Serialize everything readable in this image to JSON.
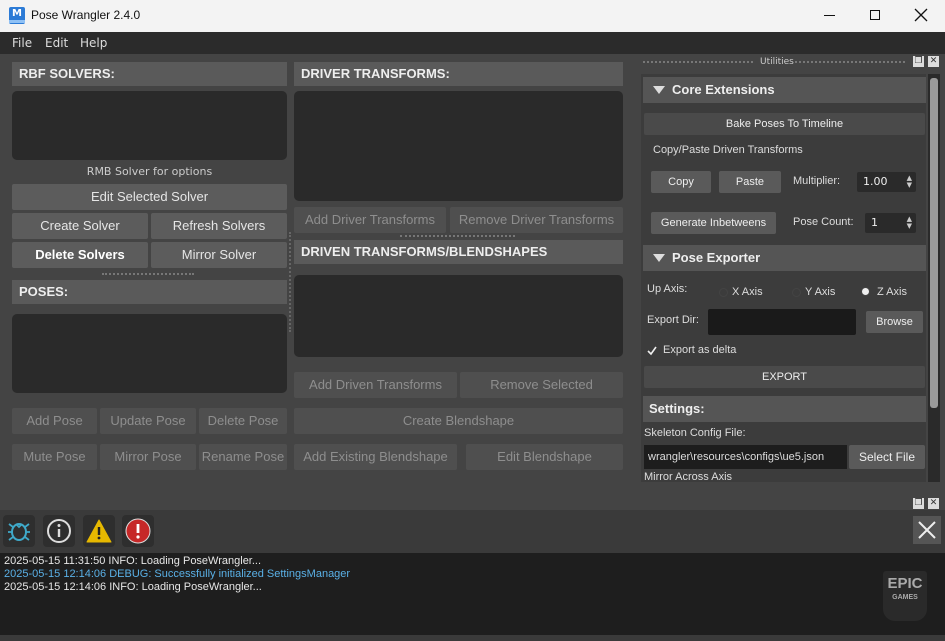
{
  "window": {
    "title": "Pose Wrangler 2.4.0",
    "icon_glyph": "M"
  },
  "menu": [
    "File",
    "Edit",
    "Help"
  ],
  "left": {
    "rbf_header": "RBF SOLVERS:",
    "rbf_hint": "RMB Solver for options",
    "edit_selected_solver": "Edit Selected Solver",
    "create_solver": "Create Solver",
    "refresh_solvers": "Refresh Solvers",
    "delete_solvers": "Delete Solvers",
    "mirror_solver": "Mirror Solver",
    "poses_header": "POSES:",
    "add_pose": "Add Pose",
    "update_pose": "Update Pose",
    "delete_pose": "Delete Pose",
    "mute_pose": "Mute Pose",
    "mirror_pose": "Mirror Pose",
    "rename_pose": "Rename Pose"
  },
  "middle": {
    "driver_header": "DRIVER TRANSFORMS:",
    "add_driver": "Add Driver Transforms",
    "remove_driver": "Remove Driver Transforms",
    "driven_header": "DRIVEN TRANSFORMS/BLENDSHAPES",
    "add_driven": "Add Driven Transforms",
    "remove_selected": "Remove Selected",
    "create_blendshape": "Create Blendshape",
    "add_existing_blendshape": "Add Existing Blendshape",
    "edit_blendshape": "Edit Blendshape"
  },
  "utilities": {
    "title": "Utilities",
    "core_header": "Core Extensions",
    "bake_poses": "Bake Poses To Timeline",
    "copy_paste_label": "Copy/Paste Driven Transforms",
    "copy": "Copy",
    "paste": "Paste",
    "multiplier_label": "Multiplier:",
    "multiplier_value": "1.00",
    "generate_inbetweens": "Generate Inbetweens",
    "pose_count_label": "Pose Count:",
    "pose_count_value": "1",
    "exporter_header": "Pose Exporter",
    "up_axis_label": "Up Axis:",
    "x_axis": "X Axis",
    "y_axis": "Y Axis",
    "z_axis": "Z Axis",
    "selected_axis": "Z Axis",
    "export_dir_label": "Export Dir:",
    "browse": "Browse",
    "export_as_delta": "Export as delta",
    "export_as_delta_checked": true,
    "export": "EXPORT",
    "settings_header": "Settings:",
    "skeleton_config_label": "Skeleton Config File:",
    "skeleton_config_path": "wrangler\\resources\\configs\\ue5.json",
    "select_file": "Select File",
    "mirror_across_axis": "Mirror Across Axis"
  },
  "log": {
    "lines": [
      {
        "text": "2025-05-15 11:31:50 INFO: Loading PoseWrangler...",
        "level": "info"
      },
      {
        "text": "2025-05-15 12:14:06 DEBUG: Successfully initialized SettingsManager",
        "level": "debug"
      },
      {
        "text": "2025-05-15 12:14:06 INFO: Loading PoseWrangler...",
        "level": "info"
      }
    ],
    "filters": [
      "debug-filter-icon",
      "info-filter-icon",
      "warning-filter-icon",
      "error-filter-icon"
    ],
    "logo_line1": "EPIC",
    "logo_line2": "GAMES"
  },
  "colors": {
    "info_text": "#e6e6e6",
    "debug_text": "#5ab0e6",
    "warning": "#e6b800",
    "error": "#c62828",
    "debug_icon": "#3fa9c9"
  }
}
